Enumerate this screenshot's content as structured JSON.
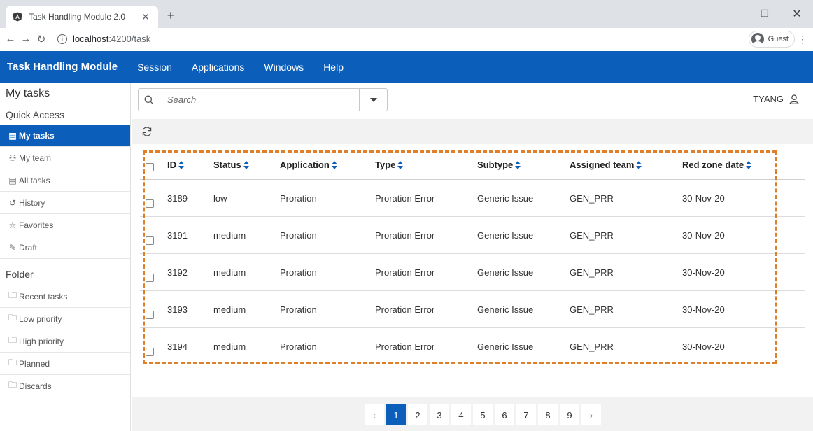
{
  "browser": {
    "tab_title": "Task Handling Module 2.0",
    "url_host": "localhost",
    "url_path": ":4200/task",
    "profile_label": "Guest"
  },
  "app": {
    "title": "Task Handling Module",
    "menu": [
      "Session",
      "Applications",
      "Windows",
      "Help"
    ]
  },
  "sidebar": {
    "title": "My tasks",
    "quick_access_label": "Quick Access",
    "quick_items": [
      {
        "label": "My tasks",
        "icon": "clipboard-icon",
        "active": true
      },
      {
        "label": "My team",
        "icon": "team-icon"
      },
      {
        "label": "All tasks",
        "icon": "list-icon"
      },
      {
        "label": "History",
        "icon": "history-icon"
      },
      {
        "label": "Favorites",
        "icon": "star-icon"
      },
      {
        "label": "Draft",
        "icon": "draft-icon"
      }
    ],
    "folder_label": "Folder",
    "folder_items": [
      {
        "label": "Recent tasks",
        "icon": "folder-open-icon"
      },
      {
        "label": "Low priority",
        "icon": "folder-open-icon"
      },
      {
        "label": "High priority",
        "icon": "folder-open-icon"
      },
      {
        "label": "Planned",
        "icon": "folder-open-icon"
      },
      {
        "label": "Discards",
        "icon": "folder-open-icon"
      }
    ]
  },
  "search": {
    "placeholder": "Search"
  },
  "user": {
    "name": "TYANG"
  },
  "table": {
    "columns": [
      "ID",
      "Status",
      "Application",
      "Type",
      "Subtype",
      "Assigned team",
      "Red zone date"
    ],
    "rows": [
      [
        "3189",
        "low",
        "Proration",
        "Proration Error",
        "Generic Issue",
        "GEN_PRR",
        "30-Nov-20"
      ],
      [
        "3191",
        "medium",
        "Proration",
        "Proration Error",
        "Generic Issue",
        "GEN_PRR",
        "30-Nov-20"
      ],
      [
        "3192",
        "medium",
        "Proration",
        "Proration Error",
        "Generic Issue",
        "GEN_PRR",
        "30-Nov-20"
      ],
      [
        "3193",
        "medium",
        "Proration",
        "Proration Error",
        "Generic Issue",
        "GEN_PRR",
        "30-Nov-20"
      ],
      [
        "3194",
        "medium",
        "Proration",
        "Proration Error",
        "Generic Issue",
        "GEN_PRR",
        "30-Nov-20"
      ]
    ]
  },
  "pagination": {
    "prev": "‹",
    "next": "›",
    "pages": [
      "1",
      "2",
      "3",
      "4",
      "5",
      "6",
      "7",
      "8",
      "9"
    ],
    "current": "1"
  },
  "colors": {
    "brand": "#0b5fba",
    "highlight": "#e07f2a"
  }
}
